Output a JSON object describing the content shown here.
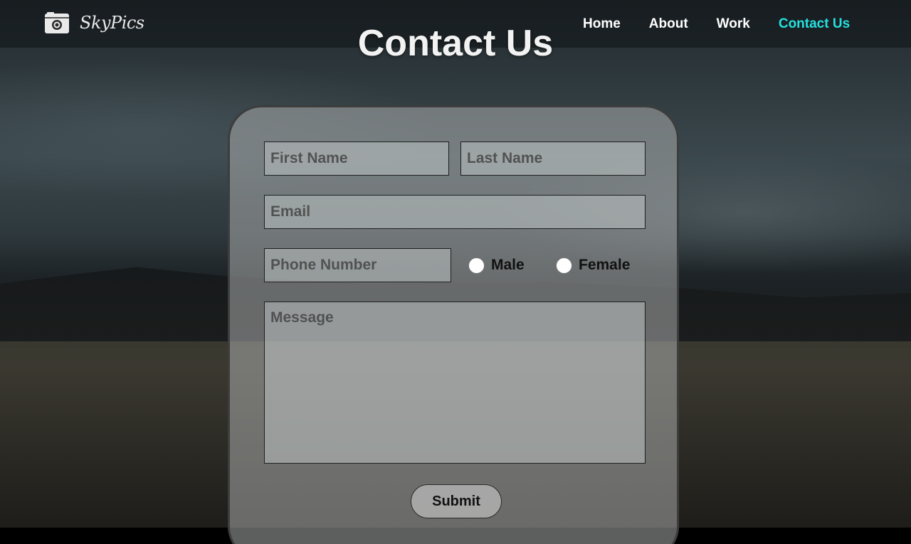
{
  "brand": {
    "name": "SkyPics",
    "icon": "camera-icon"
  },
  "nav": {
    "items": [
      {
        "label": "Home"
      },
      {
        "label": "About"
      },
      {
        "label": "Work"
      },
      {
        "label": "Contact Us",
        "active": true
      }
    ],
    "active_color": "#26e0e0"
  },
  "page": {
    "title": "Contact Us"
  },
  "form": {
    "first_name_placeholder": "First Name",
    "last_name_placeholder": "Last Name",
    "email_placeholder": "Email",
    "phone_placeholder": "Phone Number",
    "gender_options": [
      "Male",
      "Female"
    ],
    "message_placeholder": "Message",
    "submit_label": "Submit"
  }
}
